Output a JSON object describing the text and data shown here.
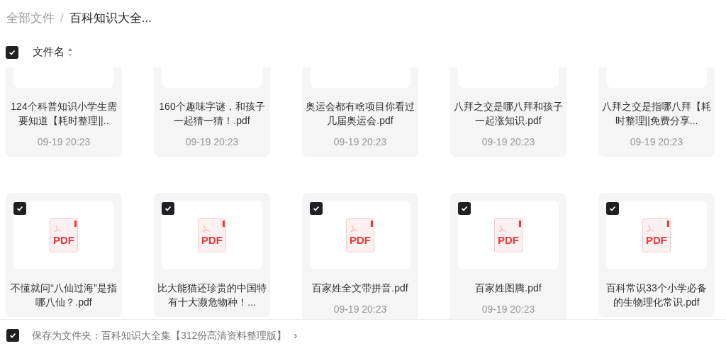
{
  "breadcrumb": {
    "root": "全部文件",
    "separator": "/",
    "current": "百科知识大全..."
  },
  "header": {
    "select_all_checked": true,
    "column": "文件名"
  },
  "rows": [
    {
      "files": [
        {
          "name": "124个科普知识小学生需要知道【耗时整理||..",
          "date": "09-19 20:23"
        },
        {
          "name": "160个趣味字谜，和孩子一起猜一猜！.pdf",
          "date": "09-19 20:23"
        },
        {
          "name": "奥运会都有啥项目你看过几届奥运会.pdf",
          "date": "09-19 20:23"
        },
        {
          "name": "八拜之交是哪八拜和孩子一起涨知识.pdf",
          "date": "09-19 20:23"
        },
        {
          "name": "八拜之交是指哪八拜【耗时整理||免费分享...",
          "date": "09-19 20:23"
        }
      ]
    },
    {
      "files": [
        {
          "checked": true,
          "icon_label": "PDF",
          "name": "不懂就问“八仙过海”是指哪八仙？.pdf"
        },
        {
          "checked": true,
          "icon_label": "PDF",
          "name": "比大能猫还珍贵的中国特有十大濒危物种！..."
        },
        {
          "checked": true,
          "icon_label": "PDF",
          "name": "百家姓全文带拼音.pdf",
          "date": "09-19 20:23"
        },
        {
          "checked": true,
          "icon_label": "PDF",
          "name": "百家姓图腾.pdf",
          "date": "09-19 20:23"
        },
        {
          "checked": true,
          "icon_label": "PDF",
          "name": "百科常识33个小学必备的生物理化常识.pdf"
        }
      ]
    }
  ],
  "footer": {
    "checked": true,
    "text": "保存为文件夹：百科知识大全集【312份高清资料整理版】",
    "chevron": "›"
  }
}
